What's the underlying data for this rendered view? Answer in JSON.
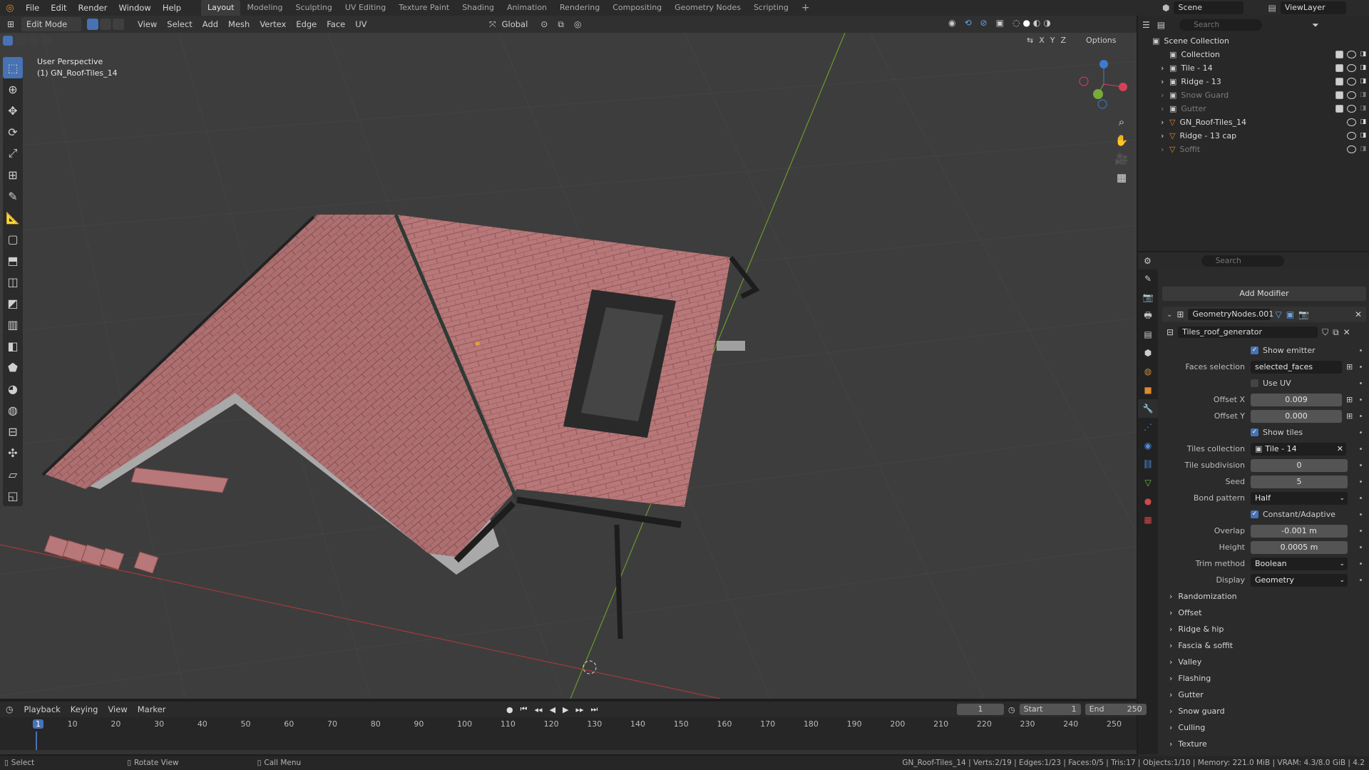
{
  "topbar": {
    "menus": [
      "File",
      "Edit",
      "Render",
      "Window",
      "Help"
    ],
    "workspaces": [
      "Layout",
      "Modeling",
      "Sculpting",
      "UV Editing",
      "Texture Paint",
      "Shading",
      "Animation",
      "Rendering",
      "Compositing",
      "Geometry Nodes",
      "Scripting"
    ],
    "active_workspace": "Layout",
    "scene": "Scene",
    "view_layer": "ViewLayer"
  },
  "viewport_header": {
    "mode": "Edit Mode",
    "menus": [
      "View",
      "Select",
      "Add",
      "Mesh",
      "Vertex",
      "Edge",
      "Face",
      "UV"
    ],
    "orientation": "Global",
    "options": "Options",
    "axes": [
      "X",
      "Y",
      "Z"
    ]
  },
  "viewport": {
    "perspective": "User Perspective",
    "object": "(1) GN_Roof-Tiles_14"
  },
  "outliner": {
    "search_placeholder": "Search",
    "scene_collection": "Scene Collection",
    "items": [
      {
        "label": "Collection",
        "dim": false
      },
      {
        "label": "Tile - 14",
        "dim": false
      },
      {
        "label": "Ridge - 13",
        "dim": false
      },
      {
        "label": "Snow Guard",
        "dim": true
      },
      {
        "label": "Gutter",
        "dim": true
      },
      {
        "label": "GN_Roof-Tiles_14",
        "dim": false
      },
      {
        "label": "Ridge - 13 cap",
        "dim": false
      },
      {
        "label": "Soffit",
        "dim": true
      }
    ]
  },
  "properties": {
    "search_placeholder": "Search",
    "add_modifier": "Add Modifier",
    "modifier_name": "GeometryNodes.001",
    "node_group": "Tiles_roof_generator",
    "show_emitter": "Show emitter",
    "faces_selection_label": "Faces selection",
    "faces_selection_value": "selected_faces",
    "use_uv": "Use UV",
    "offset_x_label": "Offset X",
    "offset_x_value": "0.009",
    "offset_y_label": "Offset Y",
    "offset_y_value": "0.000",
    "show_tiles": "Show tiles",
    "tiles_collection_label": "Tiles collection",
    "tiles_collection_value": "Tile - 14",
    "tile_subdivision_label": "Tile subdivision",
    "tile_subdivision_value": "0",
    "seed_label": "Seed",
    "seed_value": "5",
    "bond_pattern_label": "Bond pattern",
    "bond_pattern_value": "Half",
    "constant_adaptive": "Constant/Adaptive",
    "overlap_label": "Overlap",
    "overlap_value": "-0.001 m",
    "height_label": "Height",
    "height_value": "0.0005 m",
    "trim_method_label": "Trim method",
    "trim_method_value": "Boolean",
    "display_label": "Display",
    "display_value": "Geometry",
    "panels": [
      "Randomization",
      "Offset",
      "Ridge & hip",
      "Fascia & soffit",
      "Valley",
      "Flashing",
      "Gutter",
      "Snow guard",
      "Culling",
      "Texture"
    ]
  },
  "timeline": {
    "menus": [
      "Playback",
      "Keying",
      "View",
      "Marker"
    ],
    "current_frame": "1",
    "start_label": "Start",
    "start_value": "1",
    "end_label": "End",
    "end_value": "250",
    "ticks": [
      "1",
      "10",
      "20",
      "30",
      "40",
      "50",
      "60",
      "70",
      "80",
      "90",
      "100",
      "110",
      "120",
      "130",
      "140",
      "150",
      "160",
      "170",
      "180",
      "190",
      "200",
      "210",
      "220",
      "230",
      "240",
      "250"
    ]
  },
  "statusbar": {
    "select": "Select",
    "rotate": "Rotate View",
    "call_menu": "Call Menu",
    "stats": "GN_Roof-Tiles_14 | Verts:2/19 | Edges:1/23 | Faces:0/5 | Tris:17 | Objects:1/10 | Memory: 221.0 MiB | VRAM: 4.3/8.0 GiB | 4.2"
  }
}
